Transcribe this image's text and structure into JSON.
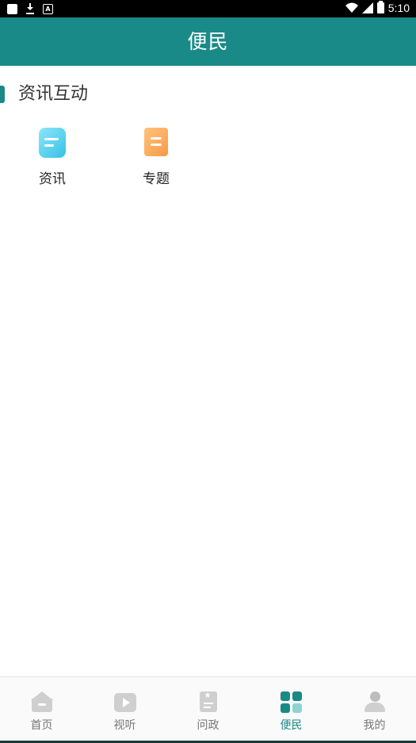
{
  "status_bar": {
    "time": "5:10"
  },
  "header": {
    "title": "便民"
  },
  "section": {
    "title": "资讯互动",
    "tiles": [
      {
        "label": "资讯",
        "icon": "news-icon",
        "color": "#37c1e6"
      },
      {
        "label": "专题",
        "icon": "topic-icon",
        "color": "#f79a45"
      }
    ]
  },
  "bottom_nav": {
    "items": [
      {
        "label": "首页",
        "icon": "home-icon",
        "active": false
      },
      {
        "label": "视听",
        "icon": "video-icon",
        "active": false
      },
      {
        "label": "问政",
        "icon": "document-icon",
        "active": false
      },
      {
        "label": "便民",
        "icon": "grid-icon",
        "active": true
      },
      {
        "label": "我的",
        "icon": "user-icon",
        "active": false
      }
    ]
  },
  "colors": {
    "accent": "#1a8a88",
    "inactive": "#cfcfcf"
  }
}
